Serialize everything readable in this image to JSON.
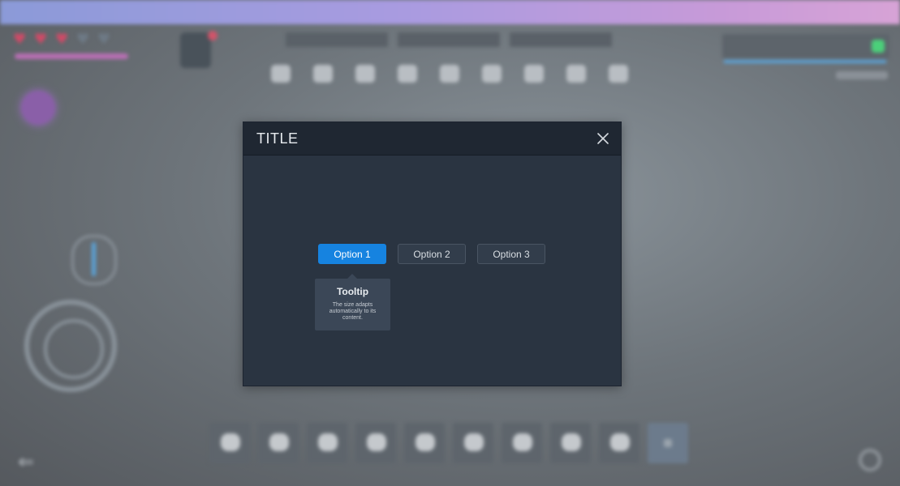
{
  "modal": {
    "title": "TITLE",
    "close_icon": "close-icon",
    "options": [
      {
        "label": "Option 1",
        "selected": true
      },
      {
        "label": "Option 2",
        "selected": false
      },
      {
        "label": "Option 3",
        "selected": false
      }
    ],
    "tooltip": {
      "title": "Tooltip",
      "text": "The size adapts automatically to its content."
    }
  },
  "colors": {
    "accent": "#1683e0",
    "modal_bg": "#2a3441",
    "header_bg": "#1f2732",
    "tooltip_bg": "#3b4757"
  },
  "background": {
    "icons": [
      "heart-icon",
      "avatar",
      "tool-icon",
      "hotbar-slot-icon",
      "back-arrow-icon",
      "gear-icon"
    ]
  }
}
